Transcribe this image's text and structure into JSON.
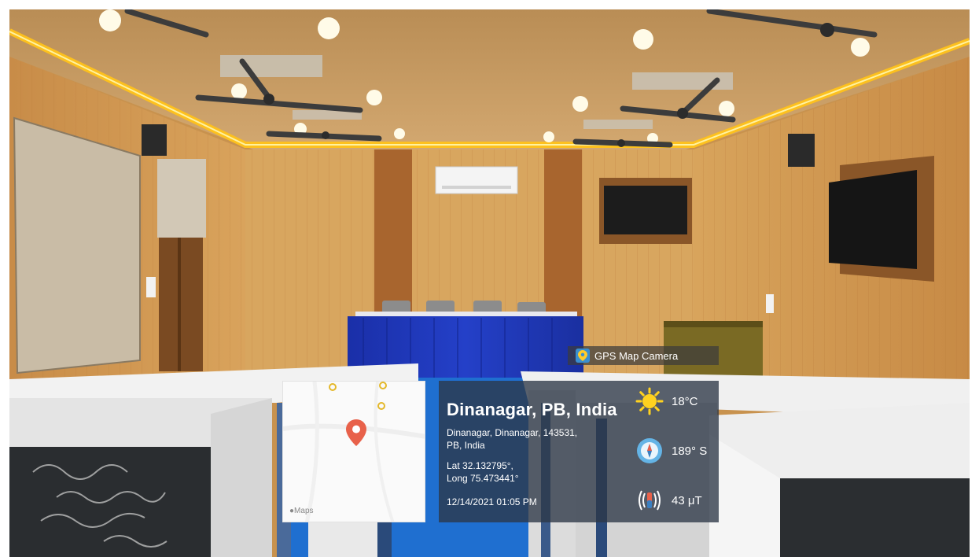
{
  "overlay": {
    "app_label": "GPS Map Camera",
    "maps_brand": "Maps",
    "location_title": "Dinanagar, PB, India",
    "address_line1": "Dinanagar, Dinanagar, 143531,",
    "address_line2": "PB, India",
    "lat": "Lat 32.132795°,",
    "long": "Long 75.473441°",
    "timestamp": "12/14/2021 01:05 PM",
    "temperature": "18°C",
    "heading": "189° S",
    "magnetic": "43 μT"
  },
  "icons": [
    "gps-camera-logo-icon",
    "map-pin-icon",
    "sun-icon",
    "compass-icon",
    "magnet-icon"
  ],
  "colors": {
    "panel": "#2d3746",
    "pin": "#e8614a",
    "sun": "#ffd21f",
    "compass": "#64b4e6"
  }
}
